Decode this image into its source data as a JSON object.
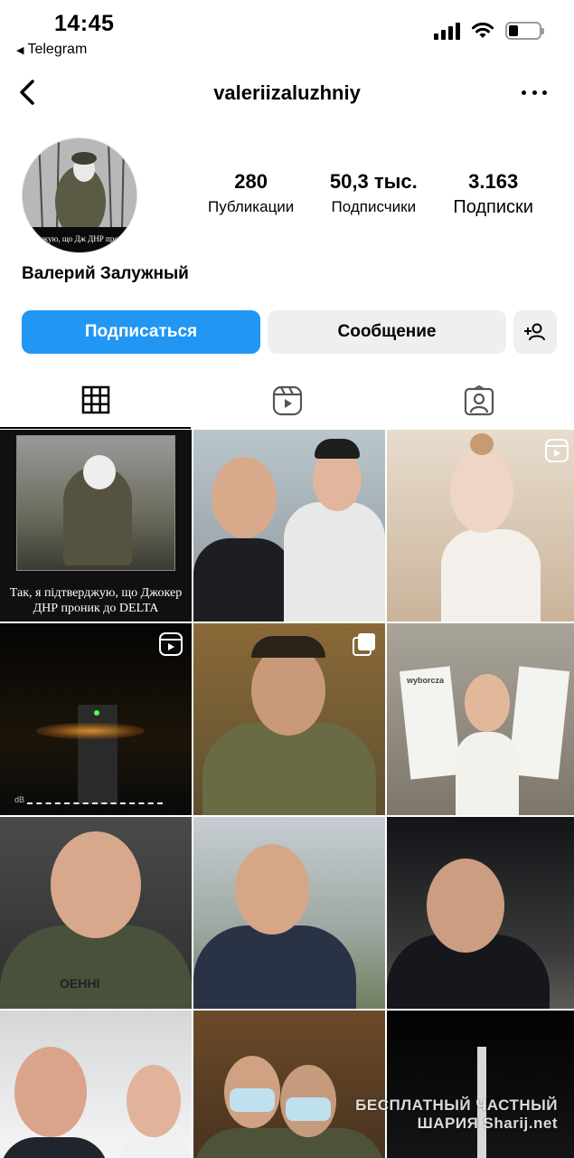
{
  "status_bar": {
    "time": "14:45",
    "back_app": "Telegram"
  },
  "header": {
    "username": "valeriizaluzhniy"
  },
  "profile": {
    "avatar_caption": "я підтверджую, що Дж ДНР проник до DE",
    "stats": [
      {
        "value": "280",
        "label": "Публикации"
      },
      {
        "value": "50,3 тыс.",
        "label": "Подписчики"
      },
      {
        "value": "3.163",
        "label": "Подписки"
      }
    ],
    "full_name": "Валерий Залужный"
  },
  "buttons": {
    "follow": "Подписаться",
    "message": "Сообщение"
  },
  "tabs": [
    "grid-icon",
    "reels-icon",
    "tagged-icon"
  ],
  "posts": [
    {
      "caption": "Так, я підтверджую, що Джокер ДНР проник до DELTA",
      "icon": ""
    },
    {
      "caption": "",
      "icon": ""
    },
    {
      "caption": "",
      "icon": "reel-icon"
    },
    {
      "caption": "",
      "icon": "reel-icon",
      "overlay_text": "dB"
    },
    {
      "caption": "",
      "icon": "carousel-icon"
    },
    {
      "caption": "",
      "icon": "",
      "overlay_text": "wyborcza"
    },
    {
      "caption": "",
      "icon": "",
      "overlay_text": "ОЕННІ"
    },
    {
      "caption": "",
      "icon": ""
    },
    {
      "caption": "",
      "icon": ""
    },
    {
      "caption": "",
      "icon": ""
    },
    {
      "caption": "",
      "icon": ""
    },
    {
      "caption": "",
      "icon": ""
    }
  ],
  "watermark": {
    "line1": "БЕСПЛАТНЫЙ ЧАСТНЫЙ",
    "line2": "ШАРИЯ Sharij.net"
  },
  "colors": {
    "follow_button": "#2196f3",
    "secondary_button": "#efefef"
  }
}
